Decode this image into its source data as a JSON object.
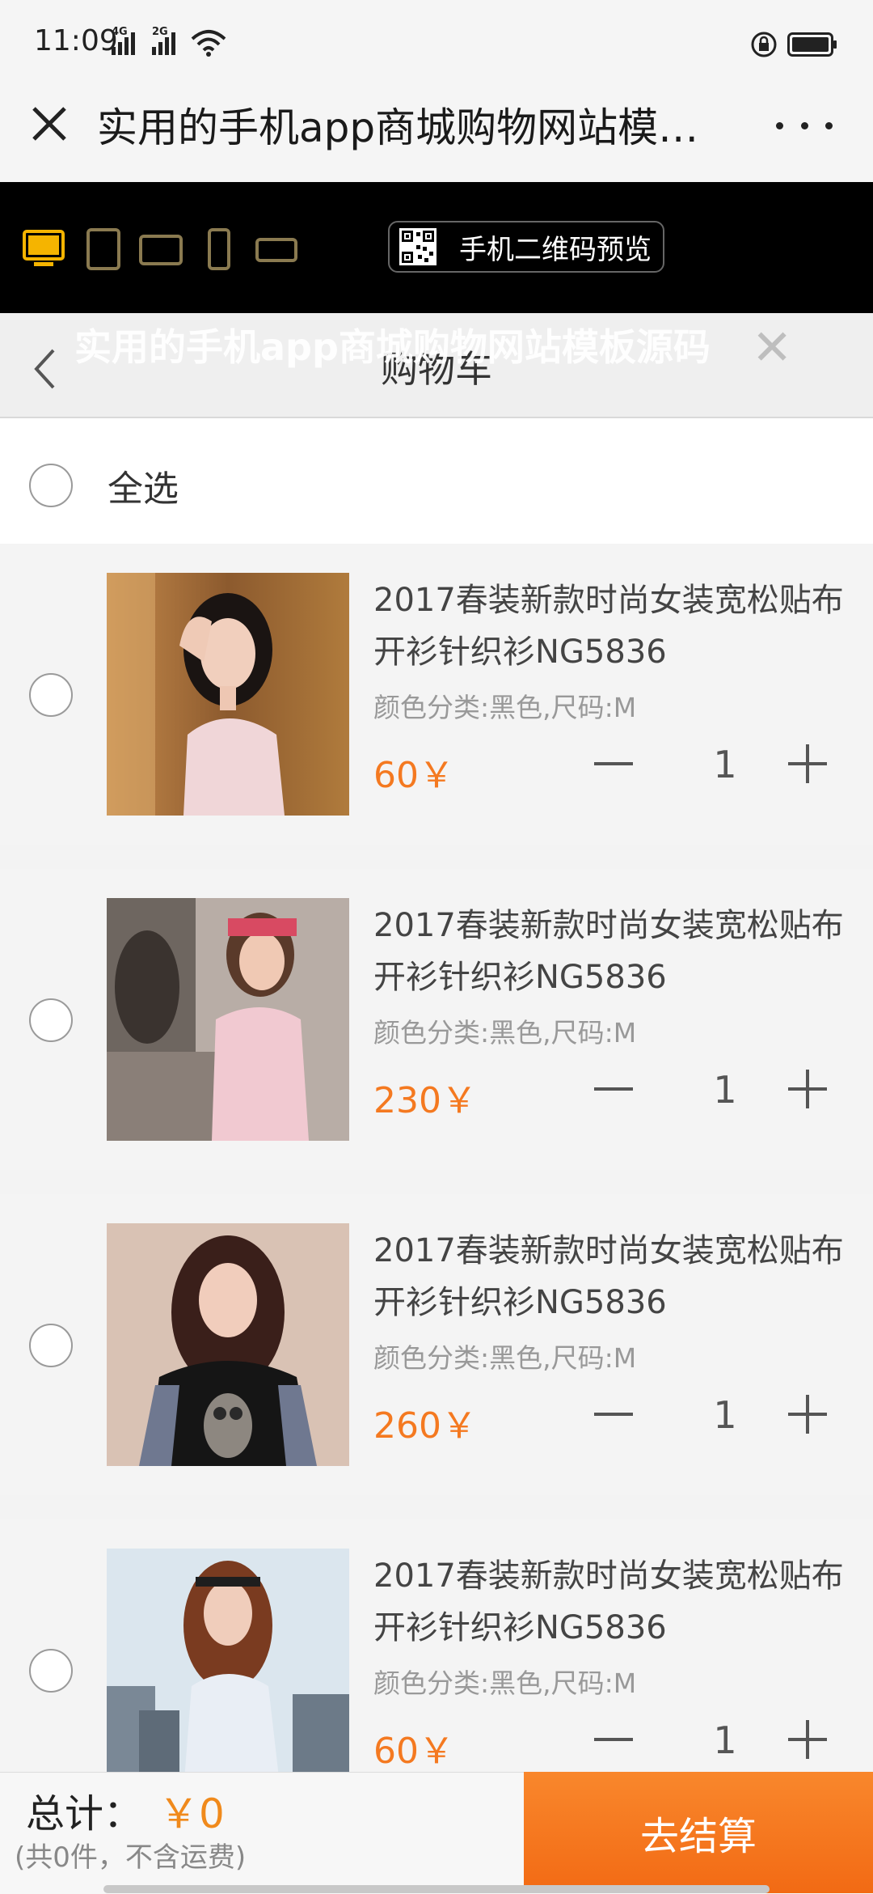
{
  "status_bar": {
    "time": "11:09",
    "signal1_tag": "4G",
    "signal2_tag": "2G"
  },
  "browser": {
    "title": "实用的手机app商城购物网站模板..."
  },
  "preview": {
    "qr_label": "手机二维码预览",
    "active_color": "#f5b400"
  },
  "cart_nav": {
    "title": "购物车",
    "watermark": "实用的手机app商城购物网站模板源码"
  },
  "select_all": {
    "label": "全选"
  },
  "items": [
    {
      "name": "2017春装新款时尚女装宽松贴布开衫针织衫NG5836",
      "spec": "颜色分类:黑色,尺码:M",
      "price": "60￥",
      "qty": "1"
    },
    {
      "name": "2017春装新款时尚女装宽松贴布开衫针织衫NG5836",
      "spec": "颜色分类:黑色,尺码:M",
      "price": "230￥",
      "qty": "1"
    },
    {
      "name": "2017春装新款时尚女装宽松贴布开衫针织衫NG5836",
      "spec": "颜色分类:黑色,尺码:M",
      "price": "260￥",
      "qty": "1"
    },
    {
      "name": "2017春装新款时尚女装宽松贴布开衫针织衫NG5836",
      "spec": "颜色分类:黑色,尺码:M",
      "price": "60￥",
      "qty": "1"
    }
  ],
  "footer": {
    "total_label": "总计：",
    "total_value": "￥0",
    "total_note": "(共0件，不含运费)",
    "checkout_label": "去结算"
  },
  "colors": {
    "price": "#f47920",
    "checkout": "#f26a14"
  }
}
